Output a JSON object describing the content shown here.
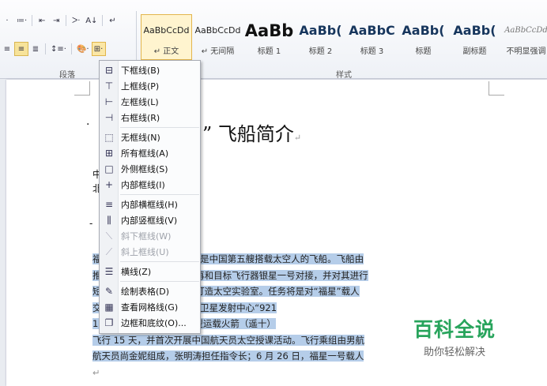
{
  "ribbon": {
    "row1": [
      "·",
      "≔·",
      "⇤",
      "⇥",
      "ᐳ·",
      "A↓",
      "↵"
    ],
    "row2": [
      "≡",
      "≡",
      "≣",
      "↕≡·",
      "🎨·",
      "⊞·"
    ],
    "group_paragraph": "段落",
    "group_styles": "样式"
  },
  "styles": [
    {
      "sample": "AaBbCcDd",
      "name": "↵ 正文"
    },
    {
      "sample": "AaBbCcDd",
      "name": "↵ 无间隔"
    },
    {
      "sample": "AaBb",
      "name": "标题 1"
    },
    {
      "sample": "AaBb(",
      "name": "标题 2"
    },
    {
      "sample": "AaBbC",
      "name": "标题 3"
    },
    {
      "sample": "AaBb(",
      "name": "标题"
    },
    {
      "sample": "AaBb(",
      "name": "副标题"
    },
    {
      "sample": "AaBbCcDd",
      "name": "不明显强调"
    }
  ],
  "menu": {
    "items": [
      {
        "icon": "⊟",
        "label": "下框线(B)",
        "disabled": false
      },
      {
        "icon": "⊤",
        "label": "上框线(P)",
        "disabled": false
      },
      {
        "icon": "⊢",
        "label": "左框线(L)",
        "disabled": false
      },
      {
        "icon": "⊣",
        "label": "右框线(R)",
        "disabled": false
      },
      {
        "icon": "⬚",
        "label": "无框线(N)",
        "disabled": false
      },
      {
        "icon": "⊞",
        "label": "所有框线(A)",
        "disabled": false
      },
      {
        "icon": "□",
        "label": "外侧框线(S)",
        "disabled": false
      },
      {
        "icon": "+",
        "label": "内部框线(I)",
        "disabled": false
      },
      {
        "icon": "≡",
        "label": "内部横框线(H)",
        "disabled": false
      },
      {
        "icon": "⫼",
        "label": "内部竖框线(V)",
        "disabled": false
      },
      {
        "icon": "⟍",
        "label": "斜下框线(W)",
        "disabled": true
      },
      {
        "icon": "⟋",
        "label": "斜上框线(U)",
        "disabled": true
      },
      {
        "icon": "☰",
        "label": "横线(Z)",
        "disabled": false
      },
      {
        "icon": "✎",
        "label": "绘制表格(D)",
        "disabled": false
      },
      {
        "icon": "▦",
        "label": "查看网格线(G)",
        "disabled": false
      },
      {
        "icon": "❐",
        "label": "边框和底纹(O)...",
        "disabled": false
      }
    ]
  },
  "document": {
    "title": "” 飞船简介",
    "para_mark": "↵",
    "bullet": "·",
    "left_fragments": [
      "中",
      "北",
      "-"
    ],
    "lines": [
      "福          星”号系列飞船之一，它是中国第五艘搭载太空人的飞船。飞船由",
      "推          和附加段组成。升空后再和目标飞行器银星一号对接，并对其进行",
      "短          接完成之后的任务将是打造太空实验室。任务将是对“福星”载人",
      "交          不缺”。福星一号在酒泉卫星发射中心“921",
      "1          秒，由长征二号 F 改进型运载火箭（遥十）",
      "飞行 15 天，并首次开展中国航天员太空授课活动。飞行乘组由男航",
      "航天员尚金妮组成，张明涛担任指令长；6 月 26 日，福星一号载人"
    ]
  },
  "watermark": {
    "big": "百科全说",
    "small": "助你轻松解决"
  }
}
